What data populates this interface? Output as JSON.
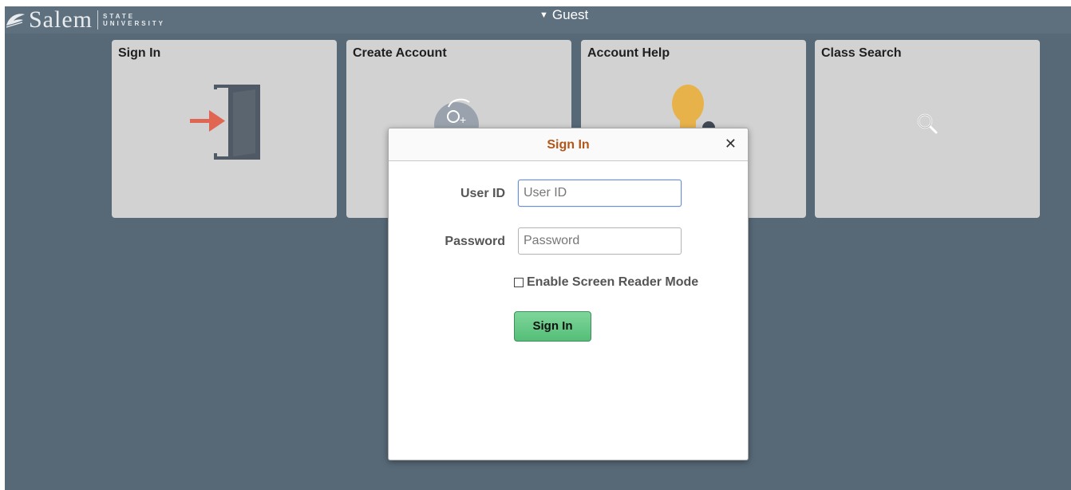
{
  "header": {
    "logo": {
      "name": "Salem",
      "sub_line1": "STATE",
      "sub_line2": "UNIVERSITY"
    },
    "user_menu": {
      "label": "Guest",
      "icon": "caret-down-icon"
    }
  },
  "tiles": [
    {
      "title": "Sign In",
      "icon": "sign-in-door-icon"
    },
    {
      "title": "Create Account",
      "icon": "add-user-icon"
    },
    {
      "title": "Account Help",
      "icon": "user-gear-icon"
    },
    {
      "title": "Class Search",
      "icon": "search-icon"
    }
  ],
  "modal": {
    "title": "Sign In",
    "close_icon": "close-icon",
    "user_id_label": "User ID",
    "user_id_placeholder": "User ID",
    "password_label": "Password",
    "password_placeholder": "Password",
    "screen_reader_label": "Enable Screen Reader Mode",
    "sign_in_button": "Sign In"
  },
  "colors": {
    "background": "#576877",
    "tile": "#d2d2d2",
    "modal_title": "#b3561a",
    "button": "#5fc47f"
  }
}
